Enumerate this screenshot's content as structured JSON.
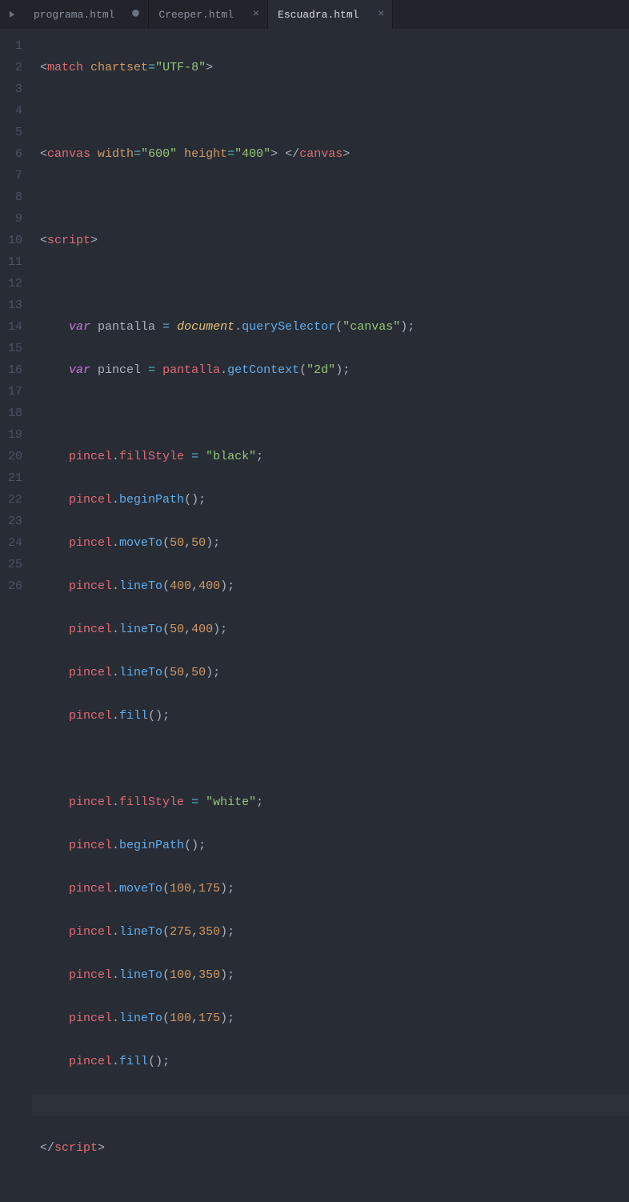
{
  "tabs": [
    {
      "title": "programa.html",
      "modified": true,
      "active": false
    },
    {
      "title": "Creeper.html",
      "modified": false,
      "active": false
    },
    {
      "title": "Escuadra.html",
      "modified": false,
      "active": true
    }
  ],
  "lineNumbers": [
    "1",
    "2",
    "3",
    "4",
    "5",
    "6",
    "7",
    "8",
    "9",
    "10",
    "11",
    "12",
    "13",
    "14",
    "15",
    "16",
    "17",
    "18",
    "19",
    "20",
    "21",
    "22",
    "23",
    "24",
    "25",
    "26"
  ],
  "code": {
    "l1": {
      "tag": "match",
      "attr1": "chartset",
      "val1": "\"UTF-8\""
    },
    "l3": {
      "tag": "canvas",
      "attr1": "width",
      "val1": "\"600\"",
      "attr2": "height",
      "val2": "\"400\"",
      "closeTag": "canvas"
    },
    "l5": {
      "tag": "script"
    },
    "l7": {
      "kw": "var",
      "v": "pantalla",
      "obj": "document",
      "m": "querySelector",
      "arg": "\"canvas\""
    },
    "l8": {
      "kw": "var",
      "v": "pincel",
      "obj": "pantalla",
      "m": "getContext",
      "arg": "\"2d\""
    },
    "l10": {
      "obj": "pincel",
      "prop": "fillStyle",
      "val": "\"black\""
    },
    "l11": {
      "obj": "pincel",
      "m": "beginPath"
    },
    "l12": {
      "obj": "pincel",
      "m": "moveTo",
      "a1": "50",
      "a2": "50"
    },
    "l13": {
      "obj": "pincel",
      "m": "lineTo",
      "a1": "400",
      "a2": "400"
    },
    "l14": {
      "obj": "pincel",
      "m": "lineTo",
      "a1": "50",
      "a2": "400"
    },
    "l15": {
      "obj": "pincel",
      "m": "lineTo",
      "a1": "50",
      "a2": "50"
    },
    "l16": {
      "obj": "pincel",
      "m": "fill"
    },
    "l18": {
      "obj": "pincel",
      "prop": "fillStyle",
      "val": "\"white\""
    },
    "l19": {
      "obj": "pincel",
      "m": "beginPath"
    },
    "l20": {
      "obj": "pincel",
      "m": "moveTo",
      "a1": "100",
      "a2": "175"
    },
    "l21": {
      "obj": "pincel",
      "m": "lineTo",
      "a1": "275",
      "a2": "350"
    },
    "l22": {
      "obj": "pincel",
      "m": "lineTo",
      "a1": "100",
      "a2": "350"
    },
    "l23": {
      "obj": "pincel",
      "m": "lineTo",
      "a1": "100",
      "a2": "175"
    },
    "l24": {
      "obj": "pincel",
      "m": "fill"
    },
    "l26": {
      "tag": "script"
    }
  }
}
